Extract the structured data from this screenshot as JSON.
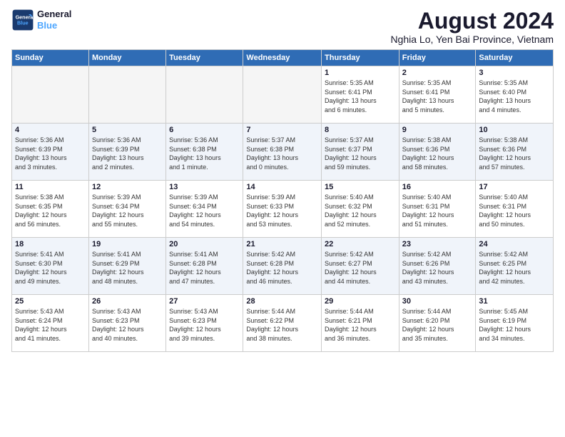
{
  "brand": {
    "name_line1": "General",
    "name_line2": "Blue"
  },
  "header": {
    "title": "August 2024",
    "subtitle": "Nghia Lo, Yen Bai Province, Vietnam"
  },
  "days_of_week": [
    "Sunday",
    "Monday",
    "Tuesday",
    "Wednesday",
    "Thursday",
    "Friday",
    "Saturday"
  ],
  "weeks": [
    [
      {
        "day": "",
        "info": ""
      },
      {
        "day": "",
        "info": ""
      },
      {
        "day": "",
        "info": ""
      },
      {
        "day": "",
        "info": ""
      },
      {
        "day": "1",
        "info": "Sunrise: 5:35 AM\nSunset: 6:41 PM\nDaylight: 13 hours\nand 6 minutes."
      },
      {
        "day": "2",
        "info": "Sunrise: 5:35 AM\nSunset: 6:41 PM\nDaylight: 13 hours\nand 5 minutes."
      },
      {
        "day": "3",
        "info": "Sunrise: 5:35 AM\nSunset: 6:40 PM\nDaylight: 13 hours\nand 4 minutes."
      }
    ],
    [
      {
        "day": "4",
        "info": "Sunrise: 5:36 AM\nSunset: 6:39 PM\nDaylight: 13 hours\nand 3 minutes."
      },
      {
        "day": "5",
        "info": "Sunrise: 5:36 AM\nSunset: 6:39 PM\nDaylight: 13 hours\nand 2 minutes."
      },
      {
        "day": "6",
        "info": "Sunrise: 5:36 AM\nSunset: 6:38 PM\nDaylight: 13 hours\nand 1 minute."
      },
      {
        "day": "7",
        "info": "Sunrise: 5:37 AM\nSunset: 6:38 PM\nDaylight: 13 hours\nand 0 minutes."
      },
      {
        "day": "8",
        "info": "Sunrise: 5:37 AM\nSunset: 6:37 PM\nDaylight: 12 hours\nand 59 minutes."
      },
      {
        "day": "9",
        "info": "Sunrise: 5:38 AM\nSunset: 6:36 PM\nDaylight: 12 hours\nand 58 minutes."
      },
      {
        "day": "10",
        "info": "Sunrise: 5:38 AM\nSunset: 6:36 PM\nDaylight: 12 hours\nand 57 minutes."
      }
    ],
    [
      {
        "day": "11",
        "info": "Sunrise: 5:38 AM\nSunset: 6:35 PM\nDaylight: 12 hours\nand 56 minutes."
      },
      {
        "day": "12",
        "info": "Sunrise: 5:39 AM\nSunset: 6:34 PM\nDaylight: 12 hours\nand 55 minutes."
      },
      {
        "day": "13",
        "info": "Sunrise: 5:39 AM\nSunset: 6:34 PM\nDaylight: 12 hours\nand 54 minutes."
      },
      {
        "day": "14",
        "info": "Sunrise: 5:39 AM\nSunset: 6:33 PM\nDaylight: 12 hours\nand 53 minutes."
      },
      {
        "day": "15",
        "info": "Sunrise: 5:40 AM\nSunset: 6:32 PM\nDaylight: 12 hours\nand 52 minutes."
      },
      {
        "day": "16",
        "info": "Sunrise: 5:40 AM\nSunset: 6:31 PM\nDaylight: 12 hours\nand 51 minutes."
      },
      {
        "day": "17",
        "info": "Sunrise: 5:40 AM\nSunset: 6:31 PM\nDaylight: 12 hours\nand 50 minutes."
      }
    ],
    [
      {
        "day": "18",
        "info": "Sunrise: 5:41 AM\nSunset: 6:30 PM\nDaylight: 12 hours\nand 49 minutes."
      },
      {
        "day": "19",
        "info": "Sunrise: 5:41 AM\nSunset: 6:29 PM\nDaylight: 12 hours\nand 48 minutes."
      },
      {
        "day": "20",
        "info": "Sunrise: 5:41 AM\nSunset: 6:28 PM\nDaylight: 12 hours\nand 47 minutes."
      },
      {
        "day": "21",
        "info": "Sunrise: 5:42 AM\nSunset: 6:28 PM\nDaylight: 12 hours\nand 46 minutes."
      },
      {
        "day": "22",
        "info": "Sunrise: 5:42 AM\nSunset: 6:27 PM\nDaylight: 12 hours\nand 44 minutes."
      },
      {
        "day": "23",
        "info": "Sunrise: 5:42 AM\nSunset: 6:26 PM\nDaylight: 12 hours\nand 43 minutes."
      },
      {
        "day": "24",
        "info": "Sunrise: 5:42 AM\nSunset: 6:25 PM\nDaylight: 12 hours\nand 42 minutes."
      }
    ],
    [
      {
        "day": "25",
        "info": "Sunrise: 5:43 AM\nSunset: 6:24 PM\nDaylight: 12 hours\nand 41 minutes."
      },
      {
        "day": "26",
        "info": "Sunrise: 5:43 AM\nSunset: 6:23 PM\nDaylight: 12 hours\nand 40 minutes."
      },
      {
        "day": "27",
        "info": "Sunrise: 5:43 AM\nSunset: 6:23 PM\nDaylight: 12 hours\nand 39 minutes."
      },
      {
        "day": "28",
        "info": "Sunrise: 5:44 AM\nSunset: 6:22 PM\nDaylight: 12 hours\nand 38 minutes."
      },
      {
        "day": "29",
        "info": "Sunrise: 5:44 AM\nSunset: 6:21 PM\nDaylight: 12 hours\nand 36 minutes."
      },
      {
        "day": "30",
        "info": "Sunrise: 5:44 AM\nSunset: 6:20 PM\nDaylight: 12 hours\nand 35 minutes."
      },
      {
        "day": "31",
        "info": "Sunrise: 5:45 AM\nSunset: 6:19 PM\nDaylight: 12 hours\nand 34 minutes."
      }
    ]
  ],
  "colors": {
    "header_bg": "#2f6cb5",
    "header_text": "#ffffff",
    "row_even": "#f0f4fa",
    "row_odd": "#ffffff",
    "empty_cell": "#f5f5f5"
  }
}
